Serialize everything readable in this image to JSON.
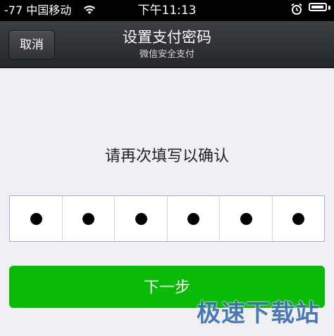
{
  "status_bar": {
    "signal_text": "-77 中国移动",
    "time": "下午11:13",
    "icons": [
      "wifi-icon",
      "alarm-icon",
      "battery-icon"
    ],
    "battery_level": 0.95
  },
  "nav": {
    "cancel_label": "取消",
    "title": "设置支付密码",
    "subtitle": "微信安全支付"
  },
  "main": {
    "prompt": "请再次填写以确认",
    "pin_digits_filled": 6,
    "pin_length": 6,
    "next_label": "下一步"
  },
  "watermark": {
    "text": "极速下载站"
  },
  "colors": {
    "accent_green": "#09bb07",
    "nav_background": "#2e3034",
    "page_background": "#efeff4"
  }
}
